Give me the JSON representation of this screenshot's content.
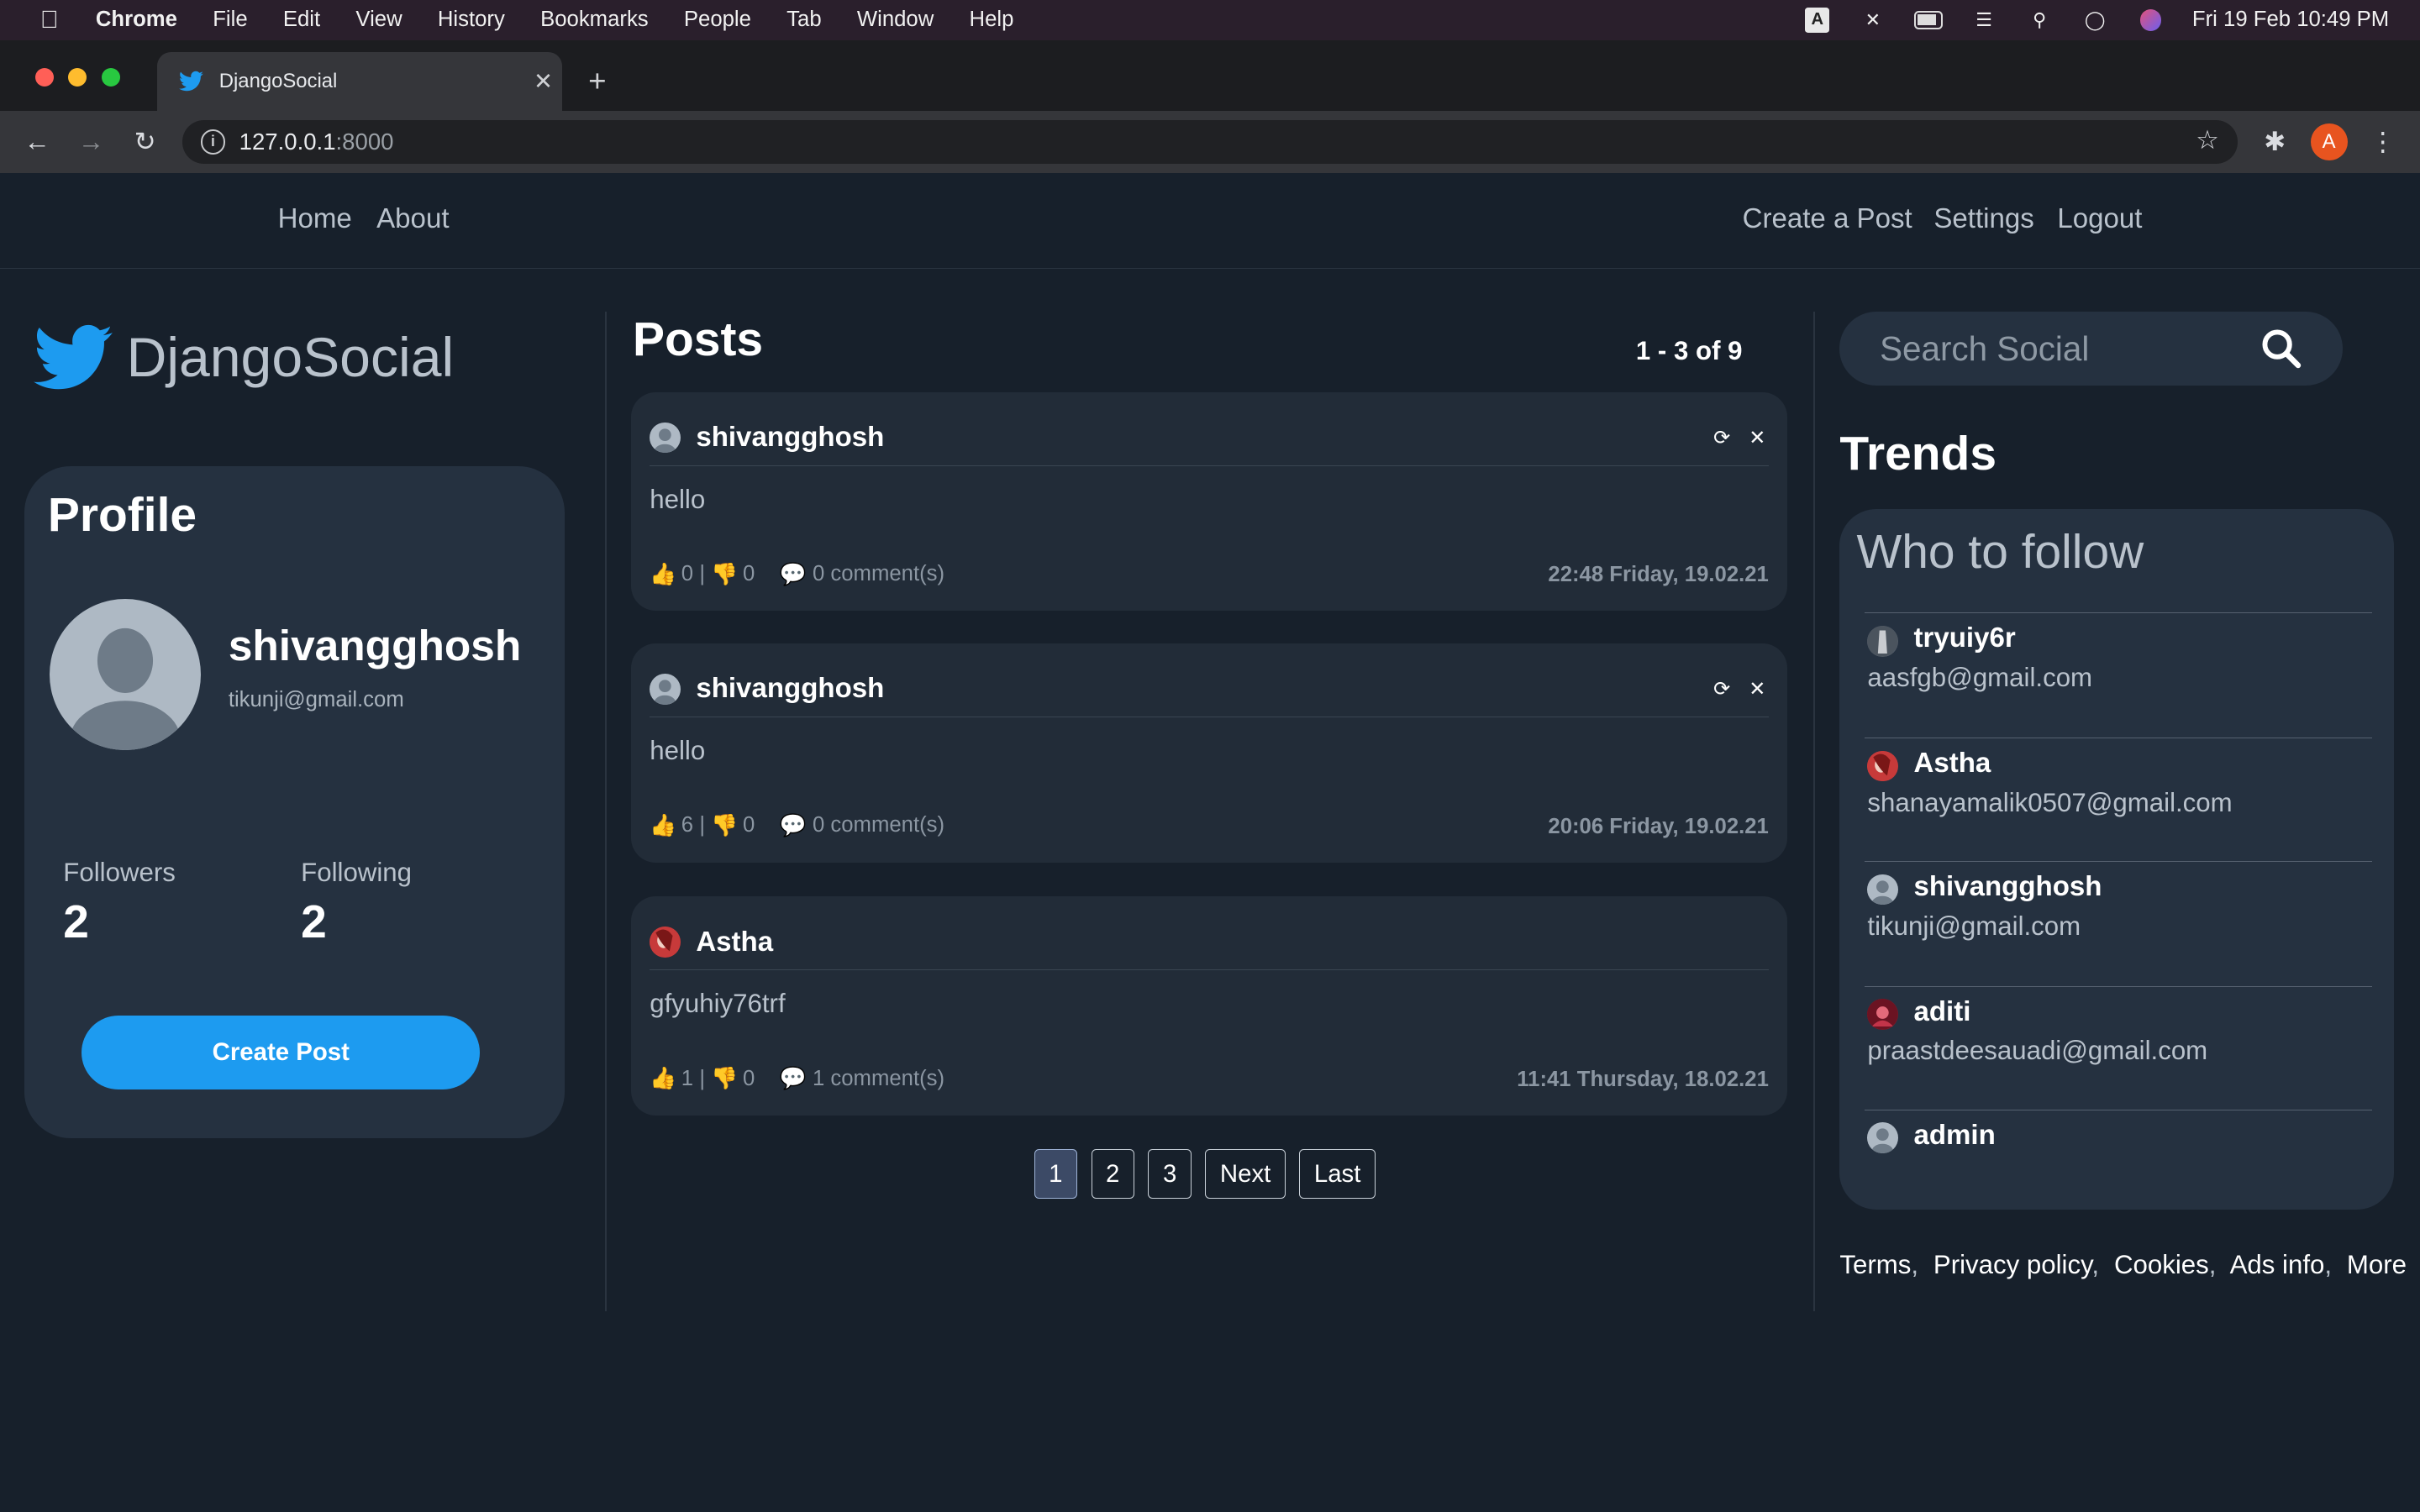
{
  "menubar": {
    "app": "Chrome",
    "items": [
      "File",
      "Edit",
      "View",
      "History",
      "Bookmarks",
      "People",
      "Tab",
      "Window",
      "Help"
    ],
    "clock": "Fri 19 Feb  10:49 PM",
    "input_indicator": "A"
  },
  "browser": {
    "tab_title": "DjangoSocial",
    "url_host": "127.0.0.1",
    "url_port": ":8000",
    "profile_initial": "A"
  },
  "nav": {
    "home": "Home",
    "about": "About",
    "create_post": "Create a Post",
    "settings": "Settings",
    "logout": "Logout"
  },
  "brand": {
    "name": "DjangoSocial",
    "color": "#1d9bf0"
  },
  "profile": {
    "title": "Profile",
    "username": "shivangghosh",
    "email": "tikunji@gmail.com",
    "followers_label": "Followers",
    "followers": "2",
    "following_label": "Following",
    "following": "2",
    "create_button": "Create Post"
  },
  "posts": {
    "title": "Posts",
    "range": "1 - 3 of 9",
    "items": [
      {
        "author": "shivangghosh",
        "body": "hello",
        "likes": "0",
        "dislikes": "0",
        "comments": "0 comment(s)",
        "date": "22:48 Friday, 19.02.21",
        "own": true
      },
      {
        "author": "shivangghosh",
        "body": "hello",
        "likes": "6",
        "dislikes": "0",
        "comments": "0 comment(s)",
        "date": "20:06 Friday, 19.02.21",
        "own": true
      },
      {
        "author": "Astha",
        "body": "gfyuhiy76trf",
        "likes": "1",
        "dislikes": "0",
        "comments": "1 comment(s)",
        "date": "11:41 Thursday, 18.02.21",
        "own": false
      }
    ]
  },
  "pagination": {
    "pages": [
      "1",
      "2",
      "3"
    ],
    "current": "1",
    "next": "Next",
    "last": "Last"
  },
  "search": {
    "placeholder": "Search Social"
  },
  "trends": {
    "title": "Trends",
    "who_to_follow": "Who to follow",
    "users": [
      {
        "name": "tryuiy6r",
        "email": "aasfgb@gmail.com"
      },
      {
        "name": "Astha",
        "email": "shanayamalik0507@gmail.com"
      },
      {
        "name": "shivangghosh",
        "email": "tikunji@gmail.com"
      },
      {
        "name": "aditi",
        "email": "praastdeesauadi@gmail.com"
      },
      {
        "name": "admin",
        "email": ""
      }
    ]
  },
  "footer": {
    "links": [
      "Terms",
      "Privacy policy",
      "Cookies",
      "Ads info",
      "More"
    ]
  },
  "colors": {
    "page_bg": "#17202b",
    "card_bg": "#253140",
    "accent": "#1d9bf0"
  }
}
